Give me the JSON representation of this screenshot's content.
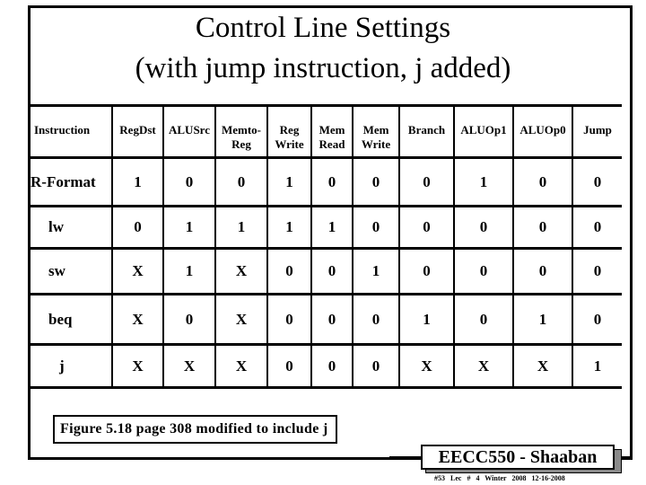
{
  "title": {
    "line1": "Control Line Settings",
    "line2": "(with jump instruction, j added)"
  },
  "table": {
    "headers": [
      {
        "line1": "Instruction",
        "line2": ""
      },
      {
        "line1": "RegDst",
        "line2": ""
      },
      {
        "line1": "ALUSrc",
        "line2": ""
      },
      {
        "line1": "Memto-",
        "line2": "Reg"
      },
      {
        "line1": "Reg",
        "line2": "Write"
      },
      {
        "line1": "Mem",
        "line2": "Read"
      },
      {
        "line1": "Mem",
        "line2": "Write"
      },
      {
        "line1": "Branch",
        "line2": ""
      },
      {
        "line1": "ALUOp1",
        "line2": ""
      },
      {
        "line1": "ALUOp0",
        "line2": ""
      },
      {
        "line1": "Jump",
        "line2": ""
      }
    ],
    "rows": [
      {
        "instruction": "R-Format",
        "values": [
          "1",
          "0",
          "0",
          "1",
          "0",
          "0",
          "0",
          "1",
          "0",
          "0"
        ]
      },
      {
        "instruction": "lw",
        "values": [
          "0",
          "1",
          "1",
          "1",
          "1",
          "0",
          "0",
          "0",
          "0",
          "0"
        ]
      },
      {
        "instruction": "sw",
        "values": [
          "X",
          "1",
          "X",
          "0",
          "0",
          "1",
          "0",
          "0",
          "0",
          "0"
        ]
      },
      {
        "instruction": "beq",
        "values": [
          "X",
          "0",
          "X",
          "0",
          "0",
          "0",
          "1",
          "0",
          "1",
          "0"
        ]
      },
      {
        "instruction": "j",
        "values": [
          "X",
          "X",
          "X",
          "0",
          "0",
          "0",
          "X",
          "X",
          "X",
          "1"
        ]
      }
    ]
  },
  "caption": "Figure 5.18 page 308 modified to include j",
  "badge": "EECC550 - Shaaban",
  "footer": "#53  Lec # 4  Winter 2008  12-16-2008"
}
